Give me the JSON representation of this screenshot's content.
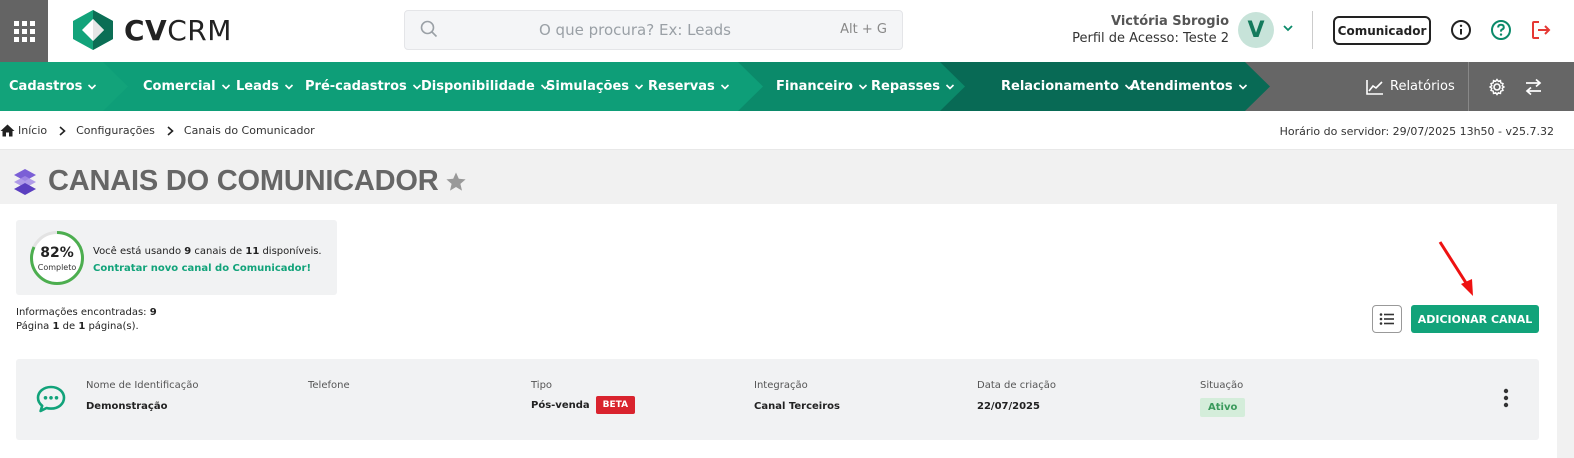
{
  "brand": {
    "logo_bold": "CV",
    "logo_rest": "CRM"
  },
  "search": {
    "placeholder": "O que procura? Ex: Leads",
    "shortcut": "Alt + G"
  },
  "user": {
    "name": "Victória Sbrogio",
    "profile": "Perfil de Acesso: Teste 2",
    "initial": "V",
    "avatar_bg": "#c7e3d9"
  },
  "header": {
    "communicator_label": "Comunicador"
  },
  "nav": {
    "groups": [
      {
        "color": "#12a37a",
        "items": [
          "Cadastros"
        ]
      },
      {
        "color": "#0e9e78",
        "items": [
          "Comercial",
          "Leads",
          "Pré-cadastros",
          "Disponibilidade",
          "Simulações",
          "Reservas"
        ]
      },
      {
        "color": "#0b8a6a",
        "items": [
          "Financeiro",
          "Repasses"
        ]
      },
      {
        "color": "#086a55",
        "items": [
          "Relacionamento",
          "Atendimentos"
        ]
      }
    ],
    "reports_label": "Relatórios"
  },
  "breadcrumb": {
    "items": [
      "Início",
      "Configurações",
      "Canais do Comunicador"
    ]
  },
  "server_time": "Horário do servidor: 29/07/2025 13h50 - v25.7.32",
  "page": {
    "title": "CANAIS DO COMUNICADOR"
  },
  "usage": {
    "percent": "82%",
    "percent_value": 82,
    "percent_label": "Completo",
    "text_prefix": "Você está usando ",
    "used": "9",
    "text_middle": " canais de ",
    "available": "11",
    "text_suffix": " disponíveis.",
    "link": "Contratar novo canal do Comunicador!"
  },
  "results": {
    "found_label": "Informações encontradas: ",
    "found_count": "9",
    "page_prefix": "Página ",
    "page_current": "1",
    "page_middle": " de ",
    "page_total": "1",
    "page_suffix": " página(s)."
  },
  "actions": {
    "add_channel": "ADICIONAR CANAL"
  },
  "columns": [
    "Nome de Identificação",
    "Telefone",
    "Tipo",
    "Integração",
    "Data de criação",
    "Situação"
  ],
  "rows": [
    {
      "name": "Demonstração",
      "phone": "",
      "type": "Pós-venda",
      "type_badge": "BETA",
      "integration": "Canal Terceiros",
      "created": "22/07/2025",
      "status": "Ativo"
    }
  ],
  "colors": {
    "accent": "#12a37a",
    "beta": "#d9232d",
    "status_active_bg": "#d4edda",
    "logout": "#e53935"
  }
}
